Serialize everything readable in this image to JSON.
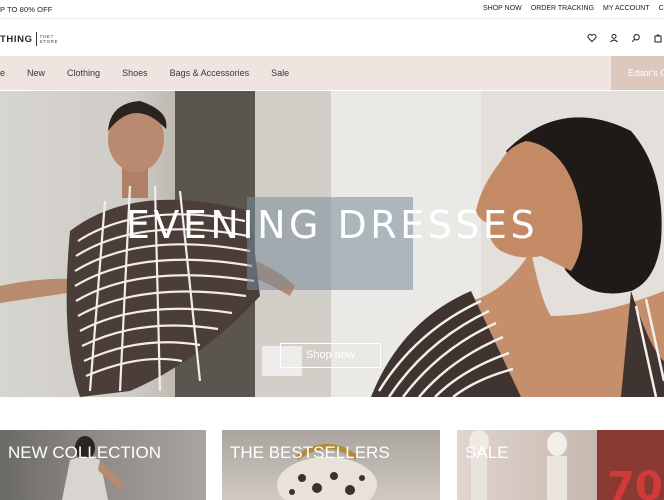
{
  "topbar": {
    "promo": "P TO 80% OFF",
    "links": [
      "SHOP NOW",
      "ORDER TRACKING",
      "MY ACCOUNT",
      "CO"
    ]
  },
  "header": {
    "logo_word": "THING",
    "logo_small_line1": "THE7",
    "logo_small_line2": "STORE",
    "icons": [
      "heart-icon",
      "user-icon",
      "search-icon",
      "cart-icon"
    ]
  },
  "nav": {
    "items": [
      "e",
      "New",
      "Clothing",
      "Shoes",
      "Bags & Accessories",
      "Sale"
    ],
    "editors": "Editor's C"
  },
  "hero": {
    "title": "EVENING DRESSES",
    "button": "Shop now"
  },
  "tiles": [
    {
      "label": "NEW COLLECTION"
    },
    {
      "label": "THE BESTSELLERS"
    },
    {
      "label": "SALE"
    }
  ]
}
